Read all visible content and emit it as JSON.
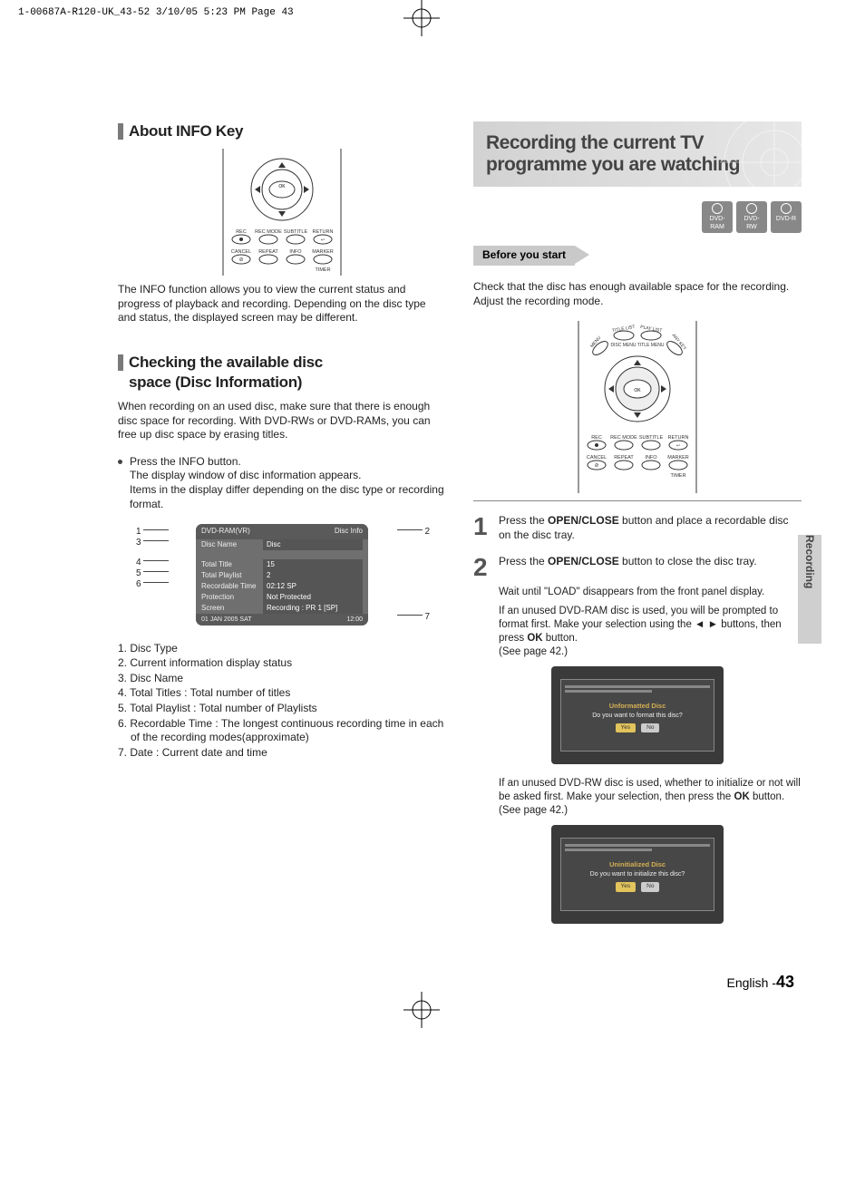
{
  "print_header": "1-00687A-R120-UK_43-52  3/10/05  5:23 PM  Page 43",
  "left": {
    "section1_title": "About INFO Key",
    "remote_labels": {
      "ok": "OK",
      "rec": "REC",
      "rec_mode": "REC MODE",
      "subtitle": "SUBTITLE",
      "return": "RETURN",
      "cancel": "CANCEL",
      "repeat": "REPEAT",
      "info": "INFO",
      "marker": "MARKER",
      "timer": "TIMER"
    },
    "section1_body": "The INFO function allows you to view the current status and progress of playback and recording. Depending on the disc type and status, the displayed screen may be different.",
    "section2_title_l1": "Checking the available disc",
    "section2_title_l2": "space (Disc Information)",
    "section2_body": "When recording on an used disc, make sure that there is enough disc space for recording. With DVD-RWs or DVD-RAMs, you can free up disc space by erasing titles.",
    "bullet_main": "Press the INFO button.",
    "bullet_sub1": "The display window of disc information appears.",
    "bullet_sub2": "Items in the display differ depending on the disc type or recording format.",
    "disc_info": {
      "header_left": "DVD-RAM(VR)",
      "header_right": "Disc Info",
      "rows": [
        {
          "lbl": "Disc Name",
          "val": "Disc"
        },
        {
          "lbl": "",
          "val": ""
        },
        {
          "lbl": "Total Title",
          "val": "15"
        },
        {
          "lbl": "Total Playlist",
          "val": "2"
        },
        {
          "lbl": "Recordable Time",
          "val": "02:12  SP"
        },
        {
          "lbl": "Protection",
          "val": "Not Protected"
        },
        {
          "lbl": "Screen",
          "val": "Recording :  PR 1 [SP]"
        }
      ],
      "footer_left": "01 JAN 2005 SAT",
      "footer_right": "12:00"
    },
    "callouts": {
      "c1": "1",
      "c2": "2",
      "c3": "3",
      "c4": "4",
      "c5": "5",
      "c6": "6",
      "c7": "7"
    },
    "numbered": [
      "1. Disc Type",
      "2. Current information display status",
      "3. Disc Name",
      "4. Total Titles : Total number of titles",
      "5. Total Playlist : Total number of Playlists",
      "6. Recordable Time : The longest continuous recording time in each of the recording modes(approximate)",
      "7. Date : Current date and time"
    ]
  },
  "right": {
    "headline": "Recording the current TV programme you are watching",
    "badges": [
      "DVD-RAM",
      "DVD-RW",
      "DVD-R"
    ],
    "before_start": "Before you start",
    "before_body": "Check that the disc has enough available space for the recording. Adjust the recording mode.",
    "remote_labels": {
      "title_list": "TITLE LIST",
      "play_list": "PLAY LIST",
      "menu": "MENU",
      "disc_menu": "DISC MENU TITLE MENU",
      "any_key": "ANY KEY",
      "ok": "OK",
      "rec": "REC",
      "rec_mode": "REC MODE",
      "subtitle": "SUBTITLE",
      "return": "RETURN",
      "cancel": "CANCEL",
      "repeat": "REPEAT",
      "info": "INFO",
      "marker": "MARKER",
      "timer": "TIMER"
    },
    "step1_num": "1",
    "step1_a": "Press the ",
    "step1_b": "OPEN/CLOSE",
    "step1_c": " button and place a recordable disc on the disc tray.",
    "step2_num": "2",
    "step2_a": "Press the ",
    "step2_b": "OPEN/CLOSE",
    "step2_c": " button to close the disc tray.",
    "step2_d1": "Wait until \"LOAD\" disappears from the front panel display.",
    "step2_d2a": "If an unused DVD-RAM disc is used, you will be prompted to format first. Make your selection using the ◄ ► buttons, then press ",
    "step2_d2b": "OK",
    "step2_d2c": " button.",
    "step2_d3": "(See page 42.)",
    "tv1_line1": "Unformatted Disc",
    "tv1_line2": "Do you want to format this disc?",
    "tv_yes": "Yes",
    "tv_no": "No",
    "step2_d4a": "If an unused DVD-RW disc is used, whether to initialize or not will be asked first. Make your selection, then press the ",
    "step2_d4b": "OK",
    "step2_d4c": " button. (See page 42.)",
    "tv2_line1": "Uninitialized Disc",
    "tv2_line2": "Do you want to initialize this disc?"
  },
  "side_tab": "Recording",
  "footer_lang": "English -",
  "footer_page": "43"
}
